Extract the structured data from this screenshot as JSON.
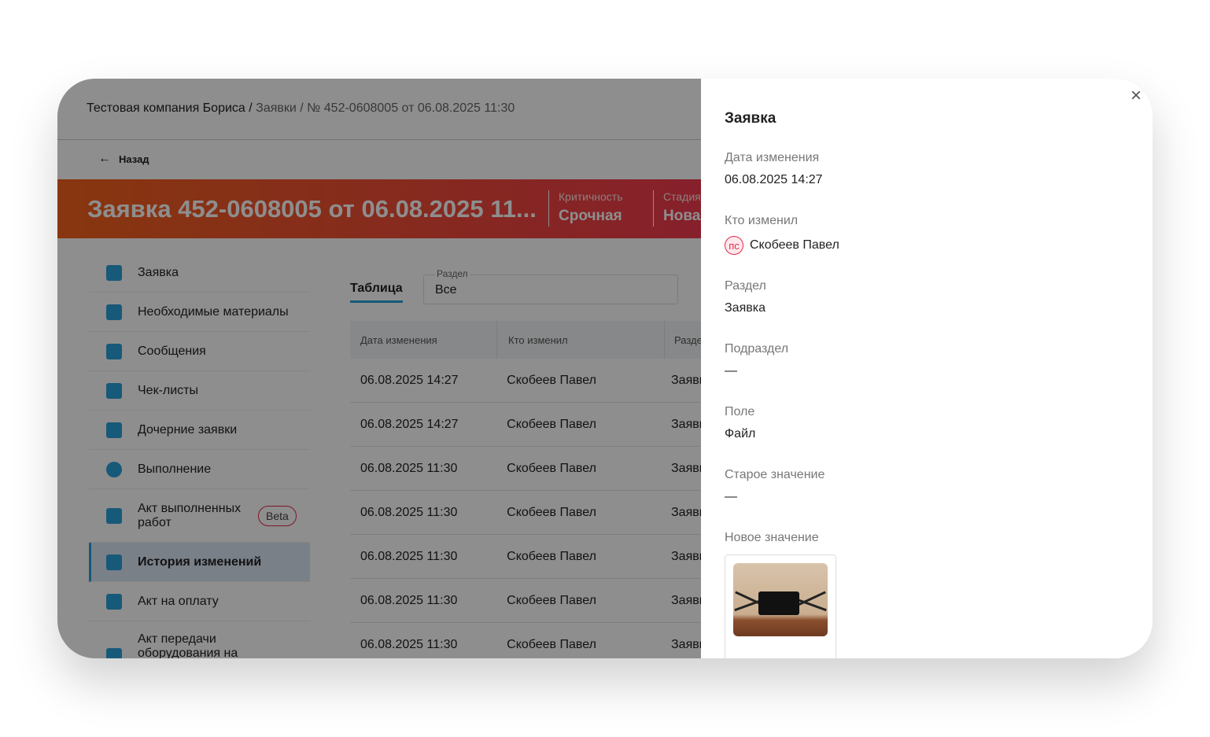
{
  "breadcrumb": {
    "company": "Тестовая компания Бориса",
    "sep": " / ",
    "section": "Заявки",
    "current": "№ 452-0608005 от 06.08.2025 11:30"
  },
  "back_label": "Назад",
  "banner": {
    "title": "Заявка 452-0608005 от 06.08.2025 11...",
    "criticality_label": "Критичность",
    "criticality_value": "Срочная",
    "stage_label": "Стадия",
    "stage_value": "Новая",
    "color_start": "#f2621c",
    "color_end": "#f03a4e"
  },
  "sidebar": {
    "items": [
      {
        "label": "Заявка",
        "icon": "clipboard-icon"
      },
      {
        "label": "Необходимые материалы",
        "icon": "boxes-icon"
      },
      {
        "label": "Сообщения",
        "icon": "message-icon"
      },
      {
        "label": "Чек-листы",
        "icon": "checklist-icon"
      },
      {
        "label": "Дочерние заявки",
        "icon": "child-requests-icon"
      },
      {
        "label": "Выполнение",
        "icon": "gear-icon"
      },
      {
        "label": "Акт выполненных работ",
        "icon": "act-icon",
        "badge": "Beta"
      },
      {
        "label": "История изменений",
        "icon": "history-icon",
        "active": true
      },
      {
        "label": "Акт на оплату",
        "icon": "invoice-icon"
      },
      {
        "label": "Акт передачи оборудования на",
        "icon": "transfer-icon"
      }
    ]
  },
  "tabs": {
    "table": "Таблица"
  },
  "filter": {
    "label": "Раздел",
    "value": "Все"
  },
  "table": {
    "headers": [
      "Дата изменения",
      "Кто изменил",
      "Раздел"
    ],
    "rows": [
      [
        "06.08.2025 14:27",
        "Скобеев Павел",
        "Заявка"
      ],
      [
        "06.08.2025 14:27",
        "Скобеев Павел",
        "Заявка"
      ],
      [
        "06.08.2025 11:30",
        "Скобеев Павел",
        "Заявка"
      ],
      [
        "06.08.2025 11:30",
        "Скобеев Павел",
        "Заявка"
      ],
      [
        "06.08.2025 11:30",
        "Скобеев Павел",
        "Заявка"
      ],
      [
        "06.08.2025 11:30",
        "Скобеев Павел",
        "Заявка"
      ],
      [
        "06.08.2025 11:30",
        "Скобеев Павел",
        "Заявка"
      ]
    ]
  },
  "panel": {
    "title": "Заявка",
    "close": "×",
    "fields": {
      "date": {
        "label": "Дата изменения",
        "value": "06.08.2025 14:27"
      },
      "who": {
        "label": "Кто изменил",
        "initials": "пс",
        "value": "Скобеев Павел"
      },
      "section": {
        "label": "Раздел",
        "value": "Заявка"
      },
      "subsection": {
        "label": "Подраздел",
        "value": "—"
      },
      "field": {
        "label": "Поле",
        "value": "Файл"
      },
      "old": {
        "label": "Старое значение",
        "value": "—"
      },
      "new": {
        "label": "Новое значение"
      }
    }
  }
}
